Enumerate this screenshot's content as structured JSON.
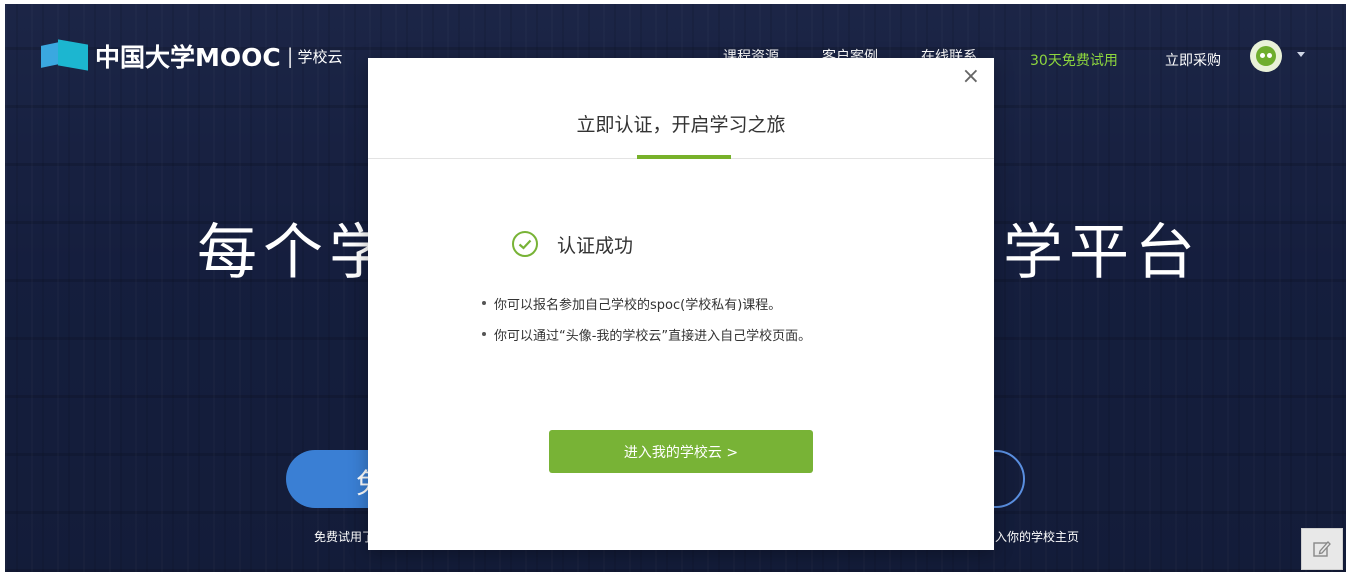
{
  "header": {
    "logo_text": "中国大学MOOC",
    "logo_separator": "|",
    "logo_sub": "学校云",
    "nav": [
      {
        "label": "课程资源"
      },
      {
        "label": "客户案例"
      },
      {
        "label": "在线联系"
      },
      {
        "label": "30天免费试用",
        "color": "#8dd63e"
      },
      {
        "label": "立即采购"
      }
    ],
    "avatar_icon": "user-avatar-icon",
    "caret_icon": "caret-down-icon"
  },
  "hero": {
    "title_left": "每个学",
    "title_right": "学平台",
    "left_button_text": "免",
    "left_caption": "免费试用了",
    "right_caption": "入你的学校主页"
  },
  "modal": {
    "close_label": "×",
    "title": "立即认证，开启学习之旅",
    "success_text": "认证成功",
    "tips": [
      "你可以报名参加自己学校的spoc(学校私有)课程。",
      "你可以通过“头像-我的学校云”直接进入自己学校页面。"
    ],
    "button_label": "进入我的学校云 >",
    "accent_color": "#78b336"
  },
  "edit_icon": "edit-icon"
}
